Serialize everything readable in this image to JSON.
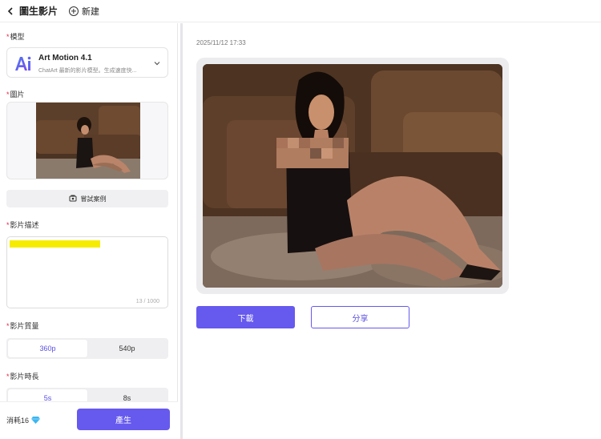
{
  "header": {
    "back_label": "圖生影片",
    "new_label": "新建"
  },
  "form": {
    "model_label": "模型",
    "model": {
      "name": "Art Motion 4.1",
      "description": "ChatArt 最新的影片模型。生成速度快..."
    },
    "image_label": "圖片",
    "sample_button": "嘗試案例",
    "description_label": "影片描述",
    "description_counter": "13 / 1000",
    "quality_label": "影片質量",
    "quality_options": [
      "360p",
      "540p"
    ],
    "quality_selected": "360p",
    "duration_label": "影片時長",
    "duration_options": [
      "5s",
      "8s"
    ],
    "duration_selected": "5s"
  },
  "footer": {
    "cost_label": "消耗16",
    "generate_button": "產生"
  },
  "result": {
    "timestamp": "2025/11/12 17:33",
    "download_button": "下載",
    "share_button": "分享"
  },
  "colors": {
    "accent": "#6659ee",
    "highlight": "#f6ec00",
    "required": "#e22244"
  },
  "icons": [
    "back-chevron-icon",
    "plus-circle-icon",
    "ai-logo-icon",
    "chevron-down-icon",
    "sample-icon",
    "gem-icon"
  ]
}
